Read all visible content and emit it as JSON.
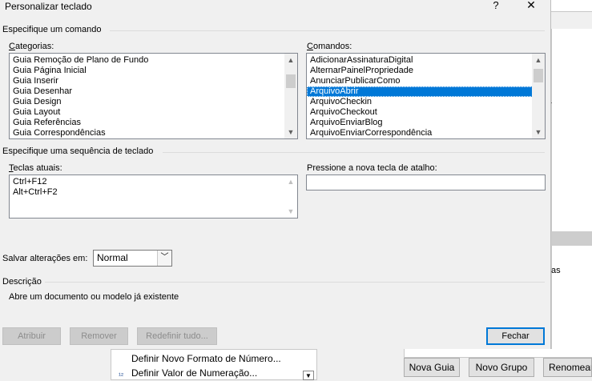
{
  "dialog": {
    "title": "Personalizar teclado",
    "help_glyph": "?",
    "close_glyph": "✕",
    "section_command": "Especifique um comando",
    "categories_label": "Categorias:",
    "commands_label": "Comandos:",
    "categories": [
      "Guia Remoção de Plano de Fundo",
      "Guia Página Inicial",
      "Guia Inserir",
      "Guia Desenhar",
      "Guia Design",
      "Guia Layout",
      "Guia Referências",
      "Guia Correspondências"
    ],
    "commands": [
      "AdicionarAssinaturaDigital",
      "AlternarPainelPropriedade",
      "AnunciarPublicarComo",
      "ArquivoAbrir",
      "ArquivoCheckin",
      "ArquivoCheckout",
      "ArquivoEnviarBlog",
      "ArquivoEnviarCorrespondência"
    ],
    "selected_command": "ArquivoAbrir",
    "section_sequence": "Especifique uma sequência de teclado",
    "current_keys_label": "Teclas atuais:",
    "current_keys": [
      "Ctrl+F12",
      "Alt+Ctrl+F2"
    ],
    "new_shortcut_label": "Pressione a nova tecla de atalho:",
    "new_shortcut_value": "",
    "save_changes_label": "Salvar alterações em:",
    "save_changes_value": "Normal",
    "section_description": "Descrição",
    "description_text": "Abre um documento ou modelo já existente",
    "btn_assign": "Atribuir",
    "btn_remove": "Remover",
    "btn_reset": "Redefinir tudo...",
    "btn_close": "Fechar"
  },
  "background": {
    "list_items": [
      "Definir Novo Formato de Número...",
      "Definir Valor de Numeração..."
    ],
    "partial_text": "as",
    "btn_new_tab": "Nova Guia",
    "btn_new_group": "Novo Grupo",
    "btn_rename": "Renomear"
  },
  "colors": {
    "selection": "#0078d7",
    "dialog_bg": "#f0f0f0",
    "primary_border": "#0078d7"
  }
}
